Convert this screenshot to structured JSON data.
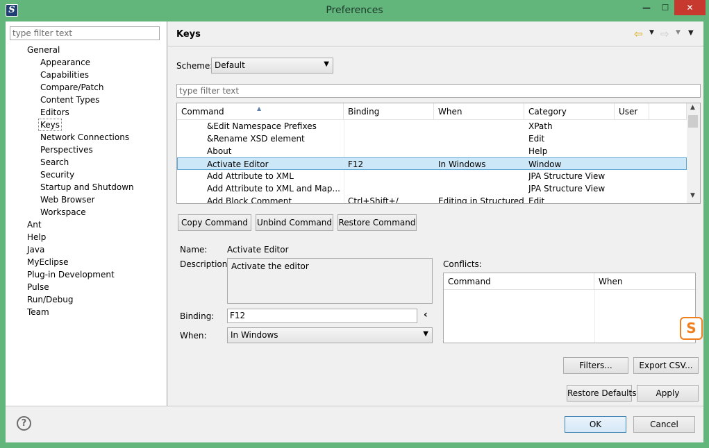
{
  "window": {
    "title": "Preferences",
    "minimize_glyph": "—",
    "maximize_glyph": "☐",
    "close_glyph": "✕",
    "app_icon_letter": "S",
    "accent_color": "#62b67c"
  },
  "sidebar": {
    "filter_placeholder": "type filter text",
    "items": [
      {
        "label": "General",
        "level": 0
      },
      {
        "label": "Appearance",
        "level": 1
      },
      {
        "label": "Capabilities",
        "level": 1
      },
      {
        "label": "Compare/Patch",
        "level": 1
      },
      {
        "label": "Content Types",
        "level": 1
      },
      {
        "label": "Editors",
        "level": 1
      },
      {
        "label": "Keys",
        "level": 1,
        "selected": true
      },
      {
        "label": "Network Connections",
        "level": 1
      },
      {
        "label": "Perspectives",
        "level": 1
      },
      {
        "label": "Search",
        "level": 1
      },
      {
        "label": "Security",
        "level": 1
      },
      {
        "label": "Startup and Shutdown",
        "level": 1
      },
      {
        "label": "Web Browser",
        "level": 1
      },
      {
        "label": "Workspace",
        "level": 1
      },
      {
        "label": "Ant",
        "level": 0
      },
      {
        "label": "Help",
        "level": 0
      },
      {
        "label": "Java",
        "level": 0
      },
      {
        "label": "MyEclipse",
        "level": 0
      },
      {
        "label": "Plug-in Development",
        "level": 0
      },
      {
        "label": "Pulse",
        "level": 0
      },
      {
        "label": "Run/Debug",
        "level": 0
      },
      {
        "label": "Team",
        "level": 0
      }
    ]
  },
  "page": {
    "title": "Keys",
    "nav_icons": [
      "back-icon",
      "forward-icon",
      "view-menu-icon"
    ],
    "scheme_label": "Scheme:",
    "scheme_value": "Default",
    "filter_placeholder": "type filter text"
  },
  "bindings_table": {
    "columns": [
      "Command",
      "Binding",
      "When",
      "Category",
      "User"
    ],
    "rows": [
      {
        "command": "&Edit Namespace Prefixes",
        "binding": "",
        "when": "",
        "category": "XPath",
        "user": ""
      },
      {
        "command": "&Rename XSD element",
        "binding": "",
        "when": "",
        "category": "Edit",
        "user": ""
      },
      {
        "command": "About",
        "binding": "",
        "when": "",
        "category": "Help",
        "user": ""
      },
      {
        "command": "Activate Editor",
        "binding": "F12",
        "when": "In Windows",
        "category": "Window",
        "user": "",
        "selected": true
      },
      {
        "command": "Add Attribute to XML",
        "binding": "",
        "when": "",
        "category": "JPA Structure View",
        "user": ""
      },
      {
        "command": "Add Attribute to XML and Map...",
        "binding": "",
        "when": "",
        "category": "JPA Structure View",
        "user": ""
      },
      {
        "command": "Add Block Comment",
        "binding": "Ctrl+Shift+/",
        "when": "Editing in Structured",
        "category": "Edit",
        "user": ""
      }
    ]
  },
  "command_buttons": {
    "copy": "Copy Command",
    "unbind": "Unbind Command",
    "restore": "Restore Command"
  },
  "details": {
    "name_label": "Name:",
    "name_value": "Activate Editor",
    "description_label": "Description:",
    "description_value": "Activate the editor",
    "binding_label": "Binding:",
    "binding_value": "F12",
    "binding_menu_glyph": "‹",
    "when_label": "When:",
    "when_value": "In Windows"
  },
  "conflicts": {
    "label": "Conflicts:",
    "columns": [
      "Command",
      "When"
    ]
  },
  "actions": {
    "filters": "Filters...",
    "export_csv": "Export CSV...",
    "restore_defaults": "Restore Defaults",
    "apply": "Apply",
    "ok": "OK",
    "cancel": "Cancel"
  },
  "help_glyph": "?",
  "tray_badge_letter": "S"
}
